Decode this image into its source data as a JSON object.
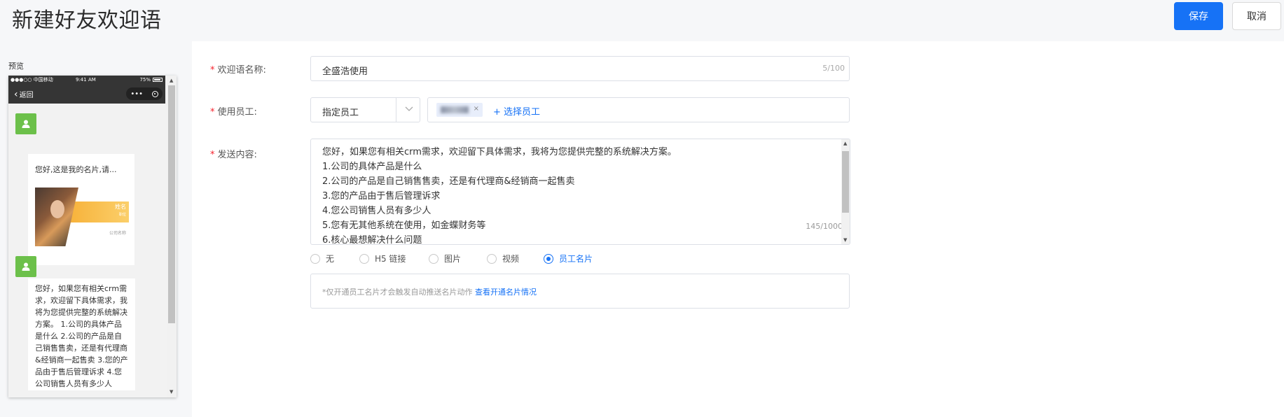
{
  "header": {
    "title": "新建好友欢迎语",
    "save_label": "保存",
    "cancel_label": "取消"
  },
  "preview": {
    "label": "预览",
    "status_bar": {
      "carrier": "●●●○○ 中国移动",
      "time": "9:41 AM",
      "battery": "75%"
    },
    "nav": {
      "back_label": "返回",
      "more_label": "•••"
    },
    "card_title": "您好,这是我的名片,请...",
    "card_name": "姓名",
    "card_sub": "职位",
    "card_company": "公司名称",
    "bubble_text": "您好，如果您有相关crm需求，欢迎留下具体需求，我将为您提供完整的系统解决方案。 1.公司的具体产品是什么 2.公司的产品是自己销售售卖，还是有代理商&经销商一起售卖 3.您的产品由于售后管理诉求 4.您公司销售人员有多少人"
  },
  "form": {
    "name": {
      "label": "欢迎语名称:",
      "value": "全盛浩使用",
      "count": "5/100"
    },
    "employees": {
      "label": "使用员工:",
      "select_value": "指定员工",
      "add_label": "+ 选择员工",
      "tag_close": "×"
    },
    "content": {
      "label": "发送内容:",
      "lines": [
        "您好，如果您有相关crm需求，欢迎留下具体需求，我将为您提供完整的系统解决方案。",
        "1.公司的具体产品是什么",
        "2.公司的产品是自己销售售卖，还是有代理商&经销商一起售卖",
        "3.您的产品由于售后管理诉求",
        "4.您公司销售人员有多少人",
        "5.您有无其他系统在使用，如金蝶财务等",
        "6.核心最想解决什么问题"
      ],
      "count": "145/1000"
    },
    "attachment_options": [
      {
        "label": "无",
        "checked": false
      },
      {
        "label": "H5 链接",
        "checked": false
      },
      {
        "label": "图片",
        "checked": false
      },
      {
        "label": "视频",
        "checked": false
      },
      {
        "label": "员工名片",
        "checked": true
      }
    ],
    "notice": {
      "text": "*仅开通员工名片才会触发自动推送名片动作",
      "link": "查看开通名片情况"
    }
  }
}
